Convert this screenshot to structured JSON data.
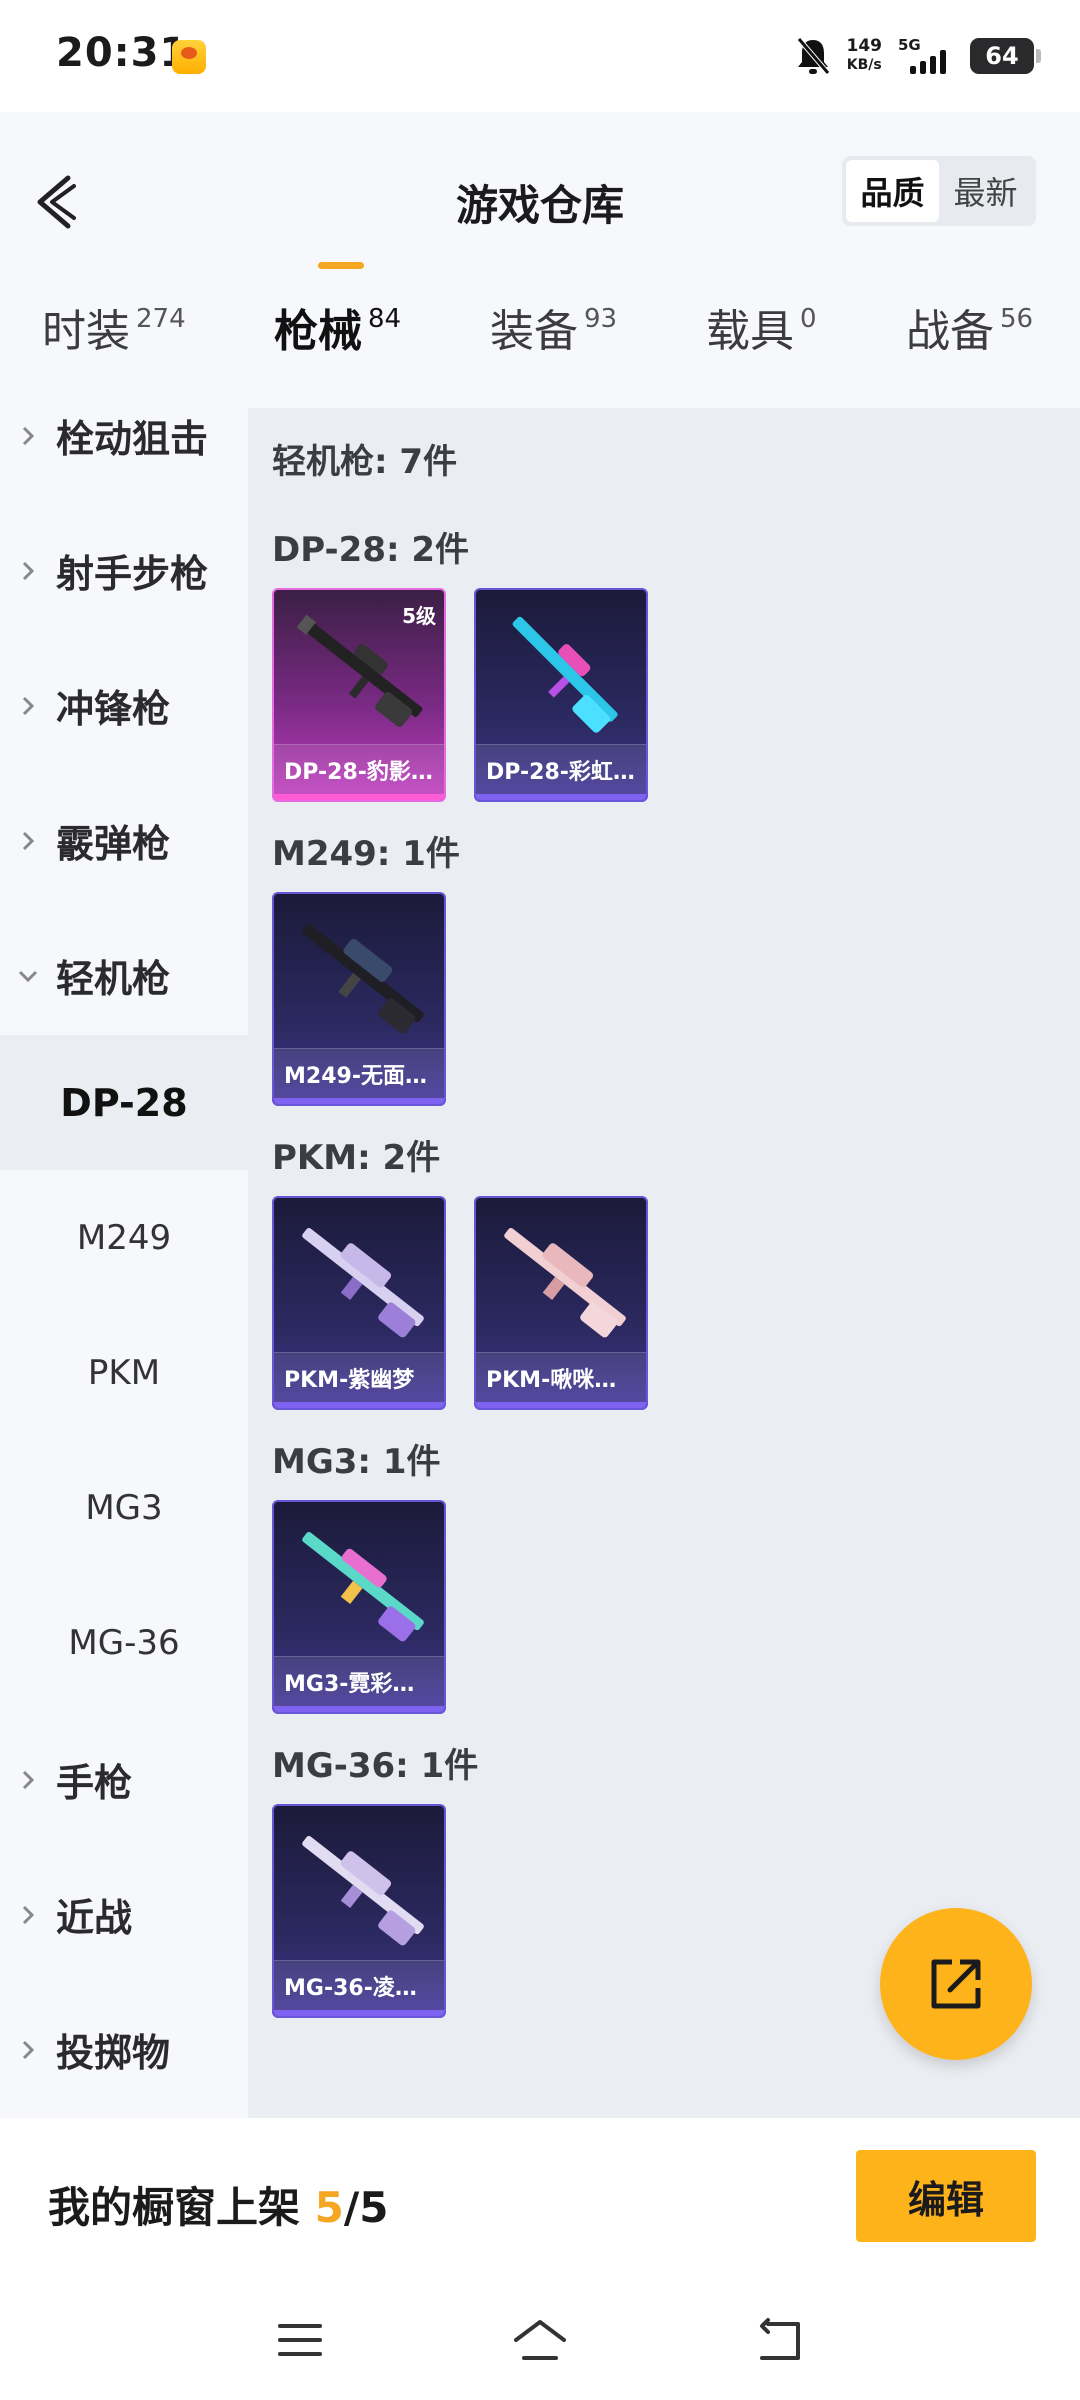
{
  "status_bar": {
    "time": "20:31",
    "net_speed": "149",
    "net_unit": "KB/s",
    "network": "5G",
    "battery": "64"
  },
  "header": {
    "title": "游戏仓库",
    "sort_options": [
      "品质",
      "最新"
    ],
    "sort_active": "品质"
  },
  "categories": [
    {
      "label": "时装",
      "count": "274"
    },
    {
      "label": "枪械",
      "count": "84",
      "active": true
    },
    {
      "label": "装备",
      "count": "93"
    },
    {
      "label": "载具",
      "count": "0"
    },
    {
      "label": "战备",
      "count": "56"
    }
  ],
  "sidebar": {
    "groups": [
      "栓动狙击",
      "射手步枪",
      "冲锋枪",
      "霰弹枪",
      "轻机枪"
    ],
    "subitems": [
      "DP-28",
      "M249",
      "PKM",
      "MG3",
      "MG-36"
    ],
    "active_sub": "DP-28",
    "groups_after": [
      "手枪",
      "近战",
      "投掷物"
    ]
  },
  "main": {
    "summary": "轻机枪: 7件",
    "sections": [
      {
        "title": "DP-28: 2件",
        "items": [
          {
            "name": "DP-28-豹影…",
            "level": "5级",
            "quality": "gold"
          },
          {
            "name": "DP-28-彩虹…",
            "level": "",
            "quality": "purple"
          }
        ]
      },
      {
        "title": "M249: 1件",
        "items": [
          {
            "name": "M249-无面…",
            "level": "",
            "quality": "purple"
          }
        ]
      },
      {
        "title": "PKM: 2件",
        "items": [
          {
            "name": "PKM-紫幽梦",
            "level": "",
            "quality": "purple"
          },
          {
            "name": "PKM-啾咪…",
            "level": "",
            "quality": "purple"
          }
        ]
      },
      {
        "title": "MG3: 1件",
        "items": [
          {
            "name": "MG3-霓彩…",
            "level": "",
            "quality": "purple"
          }
        ]
      },
      {
        "title": "MG-36: 1件",
        "items": [
          {
            "name": "MG-36-凌…",
            "level": "",
            "quality": "purple"
          }
        ]
      }
    ]
  },
  "bottom": {
    "showcase_prefix": "我的橱窗上架 ",
    "showcase_current": "5",
    "showcase_total": "/5",
    "edit_label": "编辑"
  },
  "icons": {
    "back": "back-arrow-icon",
    "share": "share-external-icon",
    "nav": [
      "menu-icon",
      "home-icon",
      "back-nav-icon"
    ]
  },
  "colors": {
    "accent": "#ffb31a",
    "highlight": "#f5a623",
    "card_purple": "#6a55d8",
    "card_gold": "#e66be0"
  }
}
